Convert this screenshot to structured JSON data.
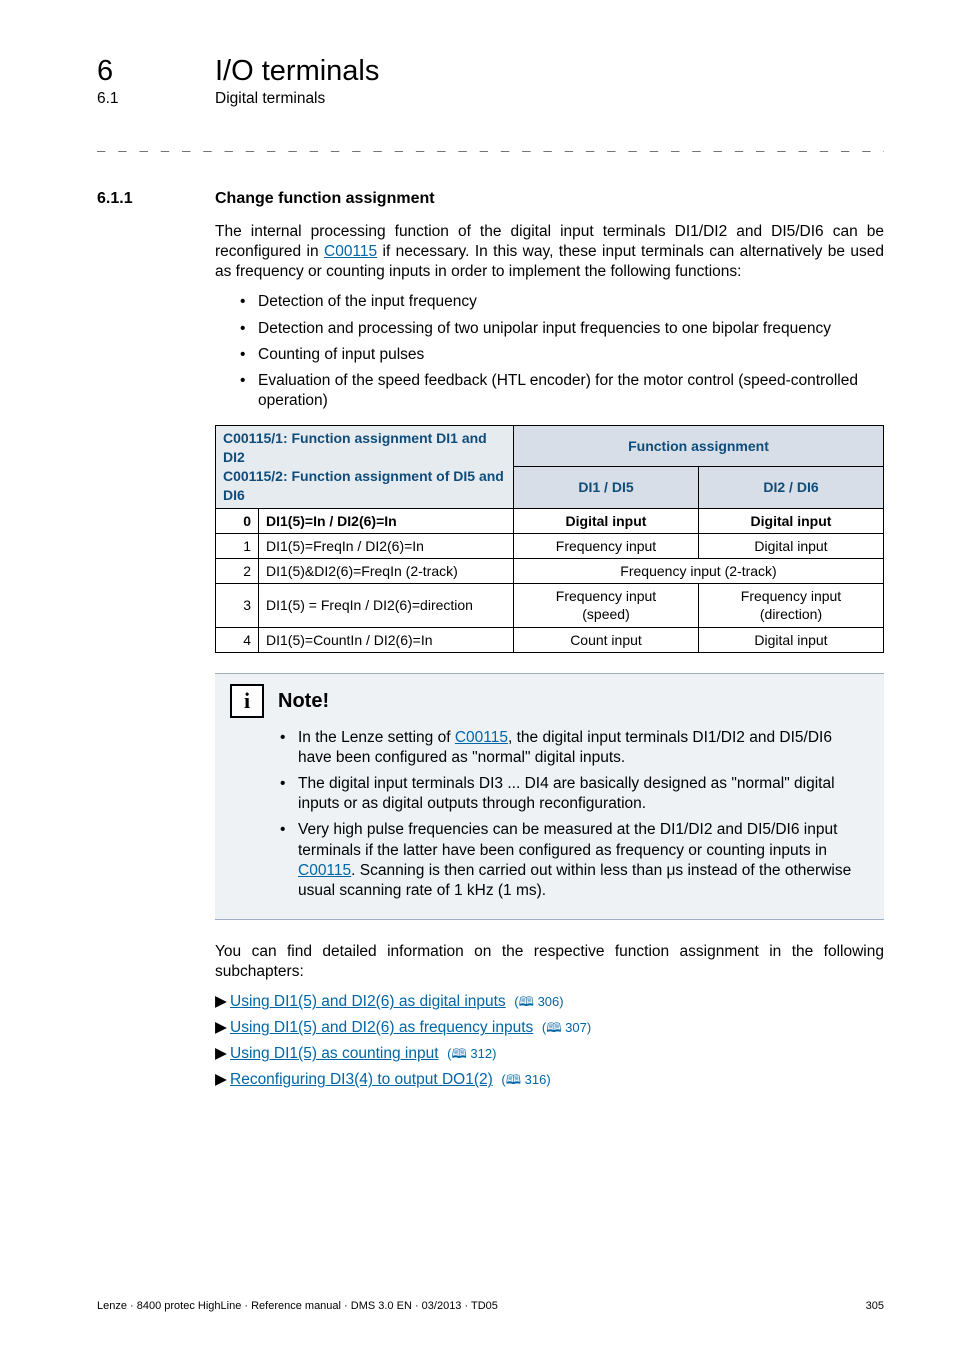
{
  "header": {
    "chapter_num": "6",
    "chapter_title": "I/O terminals",
    "section_num": "6.1",
    "section_title": "Digital terminals"
  },
  "section": {
    "num": "6.1.1",
    "title": "Change function assignment"
  },
  "intro_para": "The internal processing function of the digital input terminals DI1/DI2 and DI5/DI6 can be reconfigured in ",
  "intro_code": "C00115",
  "intro_para_after": " if necessary. In this way, these input terminals can alternatively be used as frequency or counting inputs in order to implement the following functions:",
  "bullets_main": [
    "Detection of the input frequency",
    "Detection and processing of two unipolar input frequencies to one bipolar frequency",
    "Counting of input pulses",
    "Evaluation of the speed feedback (HTL encoder) for the motor control (speed-controlled operation)"
  ],
  "table": {
    "hdr_left_l1": "C00115/1: Function assignment DI1 and DI2",
    "hdr_left_l2": "C00115/2: Function assignment of DI5 and DI6",
    "hdr_right_top": "Function assignment",
    "hdr_right_c1": "DI1 / DI5",
    "hdr_right_c2": "DI2 / DI6",
    "rows": [
      {
        "idx": "0",
        "desc": "DI1(5)=In / DI2(6)=In",
        "c1": "Digital input",
        "c2": "Digital input",
        "bold": true
      },
      {
        "idx": "1",
        "desc": "DI1(5)=FreqIn / DI2(6)=In",
        "c1": "Frequency input",
        "c2": "Digital input",
        "bold": false
      },
      {
        "idx": "2",
        "desc": "DI1(5)&DI2(6)=FreqIn (2-track)",
        "span": "Frequency input (2-track)",
        "bold": false
      },
      {
        "idx": "3",
        "desc": "DI1(5) = FreqIn / DI2(6)=direction",
        "c1": "Frequency input\n(speed)",
        "c2": "Frequency input\n(direction)",
        "bold": false
      },
      {
        "idx": "4",
        "desc": "DI1(5)=CountIn / DI2(6)=In",
        "c1": "Count input",
        "c2": "Digital input",
        "bold": false
      }
    ]
  },
  "note": {
    "title": "Note!",
    "items": [
      {
        "pre": "In the Lenze setting of ",
        "code": "C00115",
        "post": ", the digital input terminals DI1/DI2 and DI5/DI6 have been configured as \"normal\" digital inputs."
      },
      {
        "text": "The digital input terminals DI3 ... DI4 are basically designed as \"normal\" digital inputs or as digital outputs through reconfiguration."
      },
      {
        "pre": "Very high pulse frequencies can be measured at the DI1/DI2 and DI5/DI6 input terminals if the latter have been configured as frequency or counting inputs in ",
        "code": "C00115",
        "post": ". Scanning is then carried out within less than μs instead of the otherwise usual scanning rate of 1 kHz (1 ms)."
      }
    ]
  },
  "post_note_para": "You can find detailed information on the respective function assignment in the following subchapters:",
  "links": [
    {
      "text": "Using DI1(5) and DI2(6) as digital inputs",
      "page": "306"
    },
    {
      "text": "Using DI1(5) and DI2(6) as frequency inputs",
      "page": "307"
    },
    {
      "text": "Using DI1(5) as counting input",
      "page": "312"
    },
    {
      "text": "Reconfiguring DI3(4) to output DO1(2)",
      "page": "316"
    }
  ],
  "footer": {
    "left": "Lenze · 8400 protec HighLine · Reference manual · DMS 3.0 EN · 03/2013 · TD05",
    "right": "305"
  }
}
